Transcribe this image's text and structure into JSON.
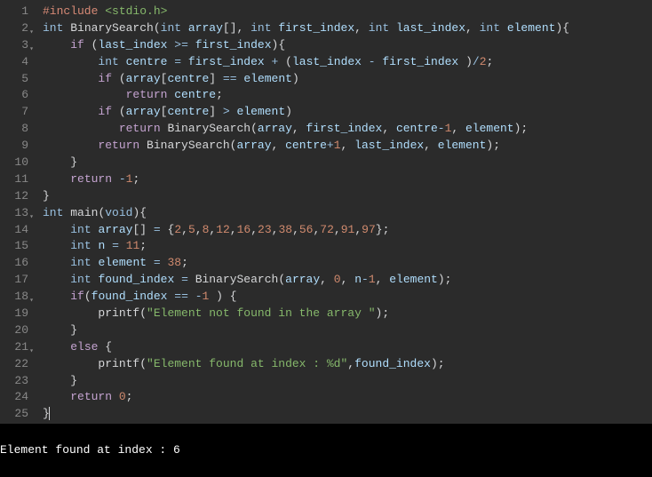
{
  "gutter": {
    "lines": [
      {
        "n": "1",
        "fold": false
      },
      {
        "n": "2",
        "fold": true
      },
      {
        "n": "3",
        "fold": true
      },
      {
        "n": "4",
        "fold": false
      },
      {
        "n": "5",
        "fold": false
      },
      {
        "n": "6",
        "fold": false
      },
      {
        "n": "7",
        "fold": false
      },
      {
        "n": "8",
        "fold": false
      },
      {
        "n": "9",
        "fold": false
      },
      {
        "n": "10",
        "fold": false
      },
      {
        "n": "11",
        "fold": false
      },
      {
        "n": "12",
        "fold": false
      },
      {
        "n": "13",
        "fold": true
      },
      {
        "n": "14",
        "fold": false
      },
      {
        "n": "15",
        "fold": false
      },
      {
        "n": "16",
        "fold": false
      },
      {
        "n": "17",
        "fold": false
      },
      {
        "n": "18",
        "fold": true
      },
      {
        "n": "19",
        "fold": false
      },
      {
        "n": "20",
        "fold": false
      },
      {
        "n": "21",
        "fold": true
      },
      {
        "n": "22",
        "fold": false
      },
      {
        "n": "23",
        "fold": false
      },
      {
        "n": "24",
        "fold": false
      },
      {
        "n": "25",
        "fold": false
      }
    ]
  },
  "code": {
    "l1": {
      "pp": "#include",
      "inc": " <stdio.h>"
    },
    "l2": {
      "t1": "int",
      "sp1": " ",
      "fn": "BinarySearch",
      "p1": "(",
      "t2": "int",
      "sp2": " ",
      "a1": "array",
      "br": "[], ",
      "t3": "int",
      "sp3": " ",
      "a2": "first_index",
      "c1": ", ",
      "t4": "int",
      "sp4": " ",
      "a3": "last_index",
      "c2": ", ",
      "t5": "int",
      "sp5": " ",
      "a4": "element",
      "p2": ")",
      "b": "{"
    },
    "l3": {
      "ind": "    ",
      "kw": "if",
      "sp": " ",
      "p1": "(",
      "v1": "last_index",
      "sp2": " ",
      "op": ">=",
      "sp3": " ",
      "v2": "first_index",
      "p2": ")",
      "b": "{"
    },
    "l4": {
      "ind": "        ",
      "t": "int",
      "sp": " ",
      "v1": "centre",
      "sp2": " ",
      "eq": "=",
      "sp3": " ",
      "v2": "first_index",
      "sp4": " ",
      "plus": "+",
      "sp5": " ",
      "p1": "(",
      "v3": "last_index",
      "sp6": " ",
      "minus": "-",
      "sp7": " ",
      "v4": "first_index",
      "sp8": " ",
      "p2": ")",
      "div": "/",
      "n": "2",
      "sc": ";"
    },
    "l5": {
      "ind": "        ",
      "kw": "if",
      "sp": " ",
      "p1": "(",
      "v1": "array",
      "br1": "[",
      "v2": "centre",
      "br2": "]",
      "sp2": " ",
      "op": "==",
      "sp3": " ",
      "v3": "element",
      "p2": ")"
    },
    "l6": {
      "ind": "            ",
      "kw": "return",
      "sp": " ",
      "v": "centre",
      "sc": ";"
    },
    "l7": {
      "ind": "        ",
      "kw": "if",
      "sp": " ",
      "p1": "(",
      "v1": "array",
      "br1": "[",
      "v2": "centre",
      "br2": "]",
      "sp2": " ",
      "op": ">",
      "sp3": " ",
      "v3": "element",
      "p2": ")"
    },
    "l8": {
      "ind": "           ",
      "kw": "return",
      "sp": " ",
      "fn": "BinarySearch",
      "p1": "(",
      "v1": "array",
      "c1": ", ",
      "v2": "first_index",
      "c2": ", ",
      "v3": "centre",
      "minus": "-",
      "n": "1",
      "c3": ", ",
      "v4": "element",
      "p2": ")",
      "sc": ";"
    },
    "l9": {
      "ind": "        ",
      "kw": "return",
      "sp": " ",
      "fn": "BinarySearch",
      "p1": "(",
      "v1": "array",
      "c1": ", ",
      "v2": "centre",
      "plus": "+",
      "n": "1",
      "c2": ", ",
      "v3": "last_index",
      "c3": ", ",
      "v4": "element",
      "p2": ")",
      "sc": ";"
    },
    "l10": {
      "ind": "    ",
      "b": "}"
    },
    "l11": {
      "ind": "    ",
      "kw": "return",
      "sp": " ",
      "minus": "-",
      "n": "1",
      "sc": ";"
    },
    "l12": {
      "b": "}"
    },
    "l13": {
      "t1": "int",
      "sp": " ",
      "fn": "main",
      "p1": "(",
      "t2": "void",
      "p2": ")",
      "b": "{"
    },
    "l14": {
      "ind": "    ",
      "t": "int",
      "sp": " ",
      "v": "array",
      "br": "[]",
      "sp2": " ",
      "eq": "=",
      "sp3": " ",
      "b1": "{",
      "n1": "2",
      "c1": ",",
      "n2": "5",
      "c2": ",",
      "n3": "8",
      "c3": ",",
      "n4": "12",
      "c4": ",",
      "n5": "16",
      "c5": ",",
      "n6": "23",
      "c6": ",",
      "n7": "38",
      "c7": ",",
      "n8": "56",
      "c8": ",",
      "n9": "72",
      "c9": ",",
      "n10": "91",
      "c10": ",",
      "n11": "97",
      "b2": "}",
      "sc": ";"
    },
    "l15": {
      "ind": "    ",
      "t": "int",
      "sp": " ",
      "v": "n",
      "sp2": " ",
      "eq": "=",
      "sp3": " ",
      "n": "11",
      "sc": ";"
    },
    "l16": {
      "ind": "    ",
      "t": "int",
      "sp": " ",
      "v": "element",
      "sp2": " ",
      "eq": "=",
      "sp3": " ",
      "n": "38",
      "sc": ";"
    },
    "l17": {
      "ind": "    ",
      "t": "int",
      "sp": " ",
      "v": "found_index",
      "sp2": " ",
      "eq": "=",
      "sp3": " ",
      "fn": "BinarySearch",
      "p1": "(",
      "v1": "array",
      "c1": ", ",
      "n1": "0",
      "c2": ", ",
      "v2": "n",
      "minus": "-",
      "n2": "1",
      "c3": ", ",
      "v3": "element",
      "p2": ")",
      "sc": ";"
    },
    "l18": {
      "ind": "    ",
      "kw": "if",
      "p1": "(",
      "v": "found_index",
      "sp": " ",
      "op": "==",
      "sp2": " ",
      "minus": "-",
      "n": "1",
      "sp3": " ",
      "p2": ")",
      "sp4": " ",
      "b": "{"
    },
    "l19": {
      "ind": "        ",
      "fn": "printf",
      "p1": "(",
      "s": "\"Element not found in the array \"",
      "p2": ")",
      "sc": ";"
    },
    "l20": {
      "ind": "    ",
      "b": "}"
    },
    "l21": {
      "ind": "    ",
      "kw": "else",
      "sp": " ",
      "b": "{"
    },
    "l22": {
      "ind": "        ",
      "fn": "printf",
      "p1": "(",
      "s": "\"Element found at index : %d\"",
      "c": ",",
      "v": "found_index",
      "p2": ")",
      "sc": ";"
    },
    "l23": {
      "ind": "    ",
      "b": "}"
    },
    "l24": {
      "ind": "    ",
      "kw": "return",
      "sp": " ",
      "n": "0",
      "sc": ";"
    },
    "l25": {
      "b": "}"
    }
  },
  "console": {
    "output": "Element found at index : 6"
  }
}
